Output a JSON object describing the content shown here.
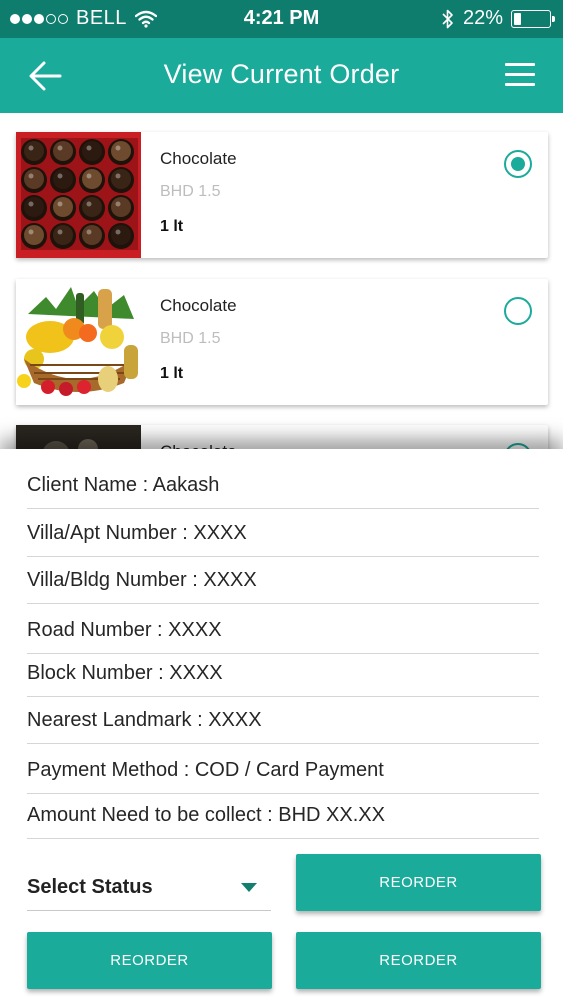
{
  "status_bar": {
    "carrier": "BELL",
    "time": "4:21 PM",
    "battery": "22%",
    "battery_level": 0.22
  },
  "header": {
    "title": "View Current Order",
    "back_icon": "arrow-left-icon",
    "menu_icon": "hamburger-menu-icon"
  },
  "products": [
    {
      "name": "Chocolate",
      "price": "BHD 1.5",
      "qty": "1 lt",
      "selected": true,
      "image": "chocolate-box-image"
    },
    {
      "name": "Chocolate",
      "price": "BHD 1.5",
      "qty": "1 lt",
      "selected": false,
      "image": "fruit-basket-image"
    },
    {
      "name": "Chocolate",
      "selected": false,
      "image": "dark-product-image"
    }
  ],
  "details": {
    "client_name": "Client Name : Aakash",
    "villa_apt": "Villa/Apt Number : XXXX",
    "villa_bldg": "Villa/Bldg Number : XXXX",
    "road": "Road Number : XXXX",
    "block": "Block Number : XXXX",
    "landmark": "Nearest Landmark : XXXX",
    "payment_method": "Payment Method : COD / Card Payment",
    "amount": "Amount Need to be collect : BHD XX.XX"
  },
  "actions": {
    "select_status": "Select Status",
    "reorder_top": "REORDER",
    "reorder_bottom_left": "REORDER",
    "reorder_bottom_right": "REORDER"
  },
  "colors": {
    "accent": "#1aab9b",
    "status_bar": "#0f7d6e"
  }
}
